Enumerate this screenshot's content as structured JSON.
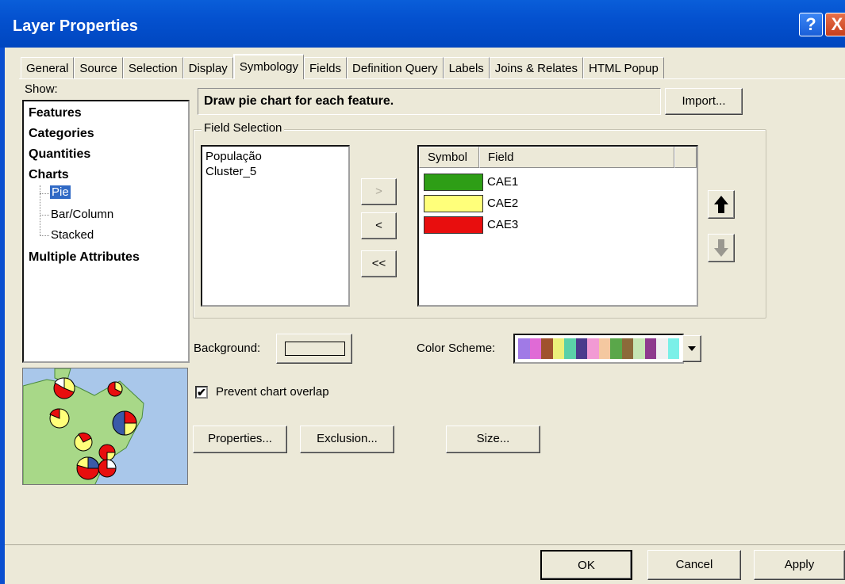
{
  "window": {
    "title": "Layer Properties",
    "help_label": "?",
    "close_label": "X"
  },
  "tabs": [
    "General",
    "Source",
    "Selection",
    "Display",
    "Symbology",
    "Fields",
    "Definition Query",
    "Labels",
    "Joins & Relates",
    "HTML Popup"
  ],
  "active_tab": "Symbology",
  "show": {
    "label": "Show:",
    "items": [
      "Features",
      "Categories",
      "Quantities",
      "Charts",
      "Multiple Attributes"
    ],
    "chart_subitems": [
      "Pie",
      "Bar/Column",
      "Stacked"
    ],
    "selected": "Pie"
  },
  "description": "Draw pie chart for each feature.",
  "import_label": "Import...",
  "field_selection": {
    "title": "Field Selection",
    "available": [
      "População",
      "Cluster_5"
    ],
    "buttons": {
      "add": ">",
      "remove": "<",
      "remove_all": "<<"
    },
    "columns": [
      "Symbol",
      "Field"
    ],
    "selected_fields": [
      {
        "field": "CAE1",
        "color": "#2e9e16"
      },
      {
        "field": "CAE2",
        "color": "#ffff7a"
      },
      {
        "field": "CAE3",
        "color": "#e80e0e"
      }
    ]
  },
  "background_label": "Background:",
  "color_scheme_label": "Color  Scheme:",
  "color_scheme_colors": [
    "#a07ae6",
    "#e06ad6",
    "#a0522d",
    "#ecf07a",
    "#5bd0a8",
    "#4b3a8c",
    "#f29ad4",
    "#f4c8a0",
    "#5aa74a",
    "#8c6a3a",
    "#c6e6b4",
    "#8e3a8e",
    "#f0f0f0",
    "#7af0e8"
  ],
  "prevent_overlap": {
    "label": "Prevent chart overlap",
    "checked": true,
    "check_mark": "✔"
  },
  "buttons": {
    "properties": "Properties...",
    "exclusion": "Exclusion...",
    "size": "Size...",
    "ok": "OK",
    "cancel": "Cancel",
    "apply": "Apply"
  },
  "icons": {
    "up": "arrow-up-icon",
    "down": "arrow-down-icon",
    "dropdown": "chevron-down-icon"
  }
}
